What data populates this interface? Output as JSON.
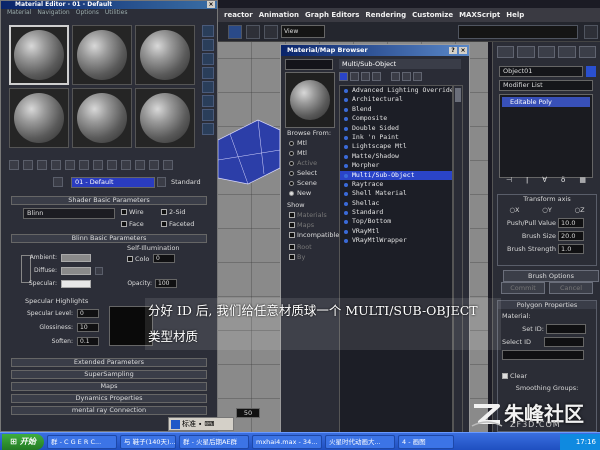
{
  "max": {
    "menu": [
      "reactor",
      "Animation",
      "Graph Editors",
      "Rendering",
      "Customize",
      "MAXScript",
      "Help"
    ],
    "view_select": "View"
  },
  "command_panel": {
    "object_name": "Object01",
    "modifier_list": "Modifier List",
    "stack_item": "Editable Poly",
    "transform_axis": "Transform axis",
    "axis": [
      "X",
      "Y",
      "Z"
    ],
    "push_pull_label": "Push/Pull Value",
    "push_pull_value": "10.0",
    "brush_size_label": "Brush Size",
    "brush_size_value": "20.0",
    "brush_strength_label": "Brush Strength",
    "brush_strength_value": "1.0",
    "brush_options": "Brush Options",
    "commit": "Commit",
    "cancel": "Cancel",
    "polygon_properties": "Polygon Properties",
    "material_label": "Material:",
    "set_id": "Set ID:",
    "select_id": "Select ID",
    "clear": "Clear",
    "smoothing_groups": "Smoothing Groups:"
  },
  "material_editor": {
    "title": "Material Editor - 01 - Default",
    "menu": [
      "Material",
      "Navigation",
      "Options",
      "Utilities"
    ],
    "material_name": "01 - Default",
    "material_type": "Standard",
    "shader_basic": "Shader Basic Parameters",
    "shader": "Blinn",
    "opt_wire": "Wire",
    "opt_2sided": "2-Sid",
    "opt_face": "Face",
    "opt_faceted": "Faceted",
    "blinn_basic": "Blinn Basic Parameters",
    "self_illum": "Self-Illumination",
    "color_label": "Colo",
    "color_value": "0",
    "ambient": "Ambient:",
    "diffuse": "Diffuse:",
    "specular": "Specular:",
    "opacity_label": "Opacity:",
    "opacity_value": "100",
    "spec_highlights": "Specular Highlights",
    "spec_level_label": "Specular Level:",
    "spec_level_value": "0",
    "glossiness_label": "Glossiness:",
    "glossiness_value": "10",
    "soften_label": "Soften:",
    "soften_value": "0.1",
    "rollouts": [
      "Extended Parameters",
      "SuperSampling",
      "Maps",
      "Dynamics Properties",
      "mental ray Connection"
    ]
  },
  "browser": {
    "title": "Material/Map Browser",
    "header": "Multi/Sub-Object",
    "browse_from": "Browse From:",
    "browse_options": [
      "Mtl",
      "Mtl",
      "Active",
      "Select",
      "Scene",
      "New"
    ],
    "show_label": "Show",
    "show_options": [
      "Materials",
      "Maps",
      "Incompatible"
    ],
    "extra_options": [
      "Root",
      "By"
    ],
    "items": [
      "Advanced Lighting Override",
      "Architectural",
      "Blend",
      "Composite",
      "Double Sided",
      "Ink 'n Paint",
      "Lightscape Mtl",
      "Matte/Shadow",
      "Morpher",
      "Multi/Sub-Object",
      "Raytrace",
      "Shell Material",
      "Shellac",
      "Standard",
      "Top/Bottom",
      "VRayMtl",
      "VRayMtlWrapper"
    ],
    "selected_index": 9
  },
  "annotation": {
    "line1": "分好 ID 后, 我们给任意材质球一个 MULTI/SUB-OBJECT",
    "line2": "类型材质"
  },
  "bottom": {
    "ime_label": "标准",
    "coord_value": "50"
  },
  "taskbar": {
    "start": "开始",
    "tasks": [
      "群 - C G E R C...",
      "与 鞋子(140天)...",
      "群 - 火星后期AE群",
      "mxhai4.max - 34...",
      "火星时代动画大...",
      "4 - 画图"
    ],
    "time": "17:16"
  },
  "watermark": {
    "text": "朱峰社区",
    "url": "ZF3D.COM"
  }
}
